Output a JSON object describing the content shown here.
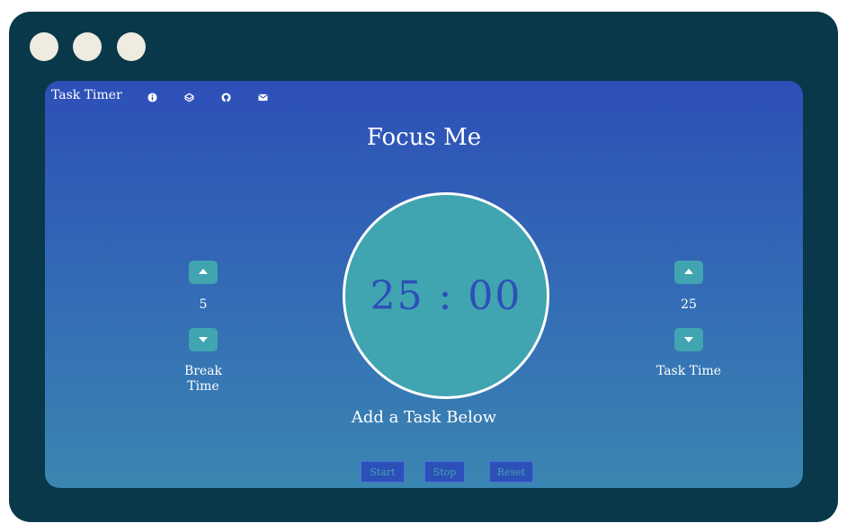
{
  "window": {
    "controls": [
      "circle-1",
      "circle-2",
      "circle-3"
    ]
  },
  "navbar": {
    "brand": "Task Timer",
    "icons": [
      "info-icon",
      "codepen-icon",
      "github-icon",
      "mail-icon"
    ]
  },
  "main": {
    "title": "Focus Me",
    "timer": {
      "display": "25 : 00"
    },
    "break": {
      "value": "5",
      "label": "Break Time"
    },
    "task": {
      "value": "25",
      "label": "Task Time"
    },
    "task_label": "Add a Task Below"
  },
  "controls": {
    "start": "Start",
    "stop": "Stop",
    "reset": "Reset"
  },
  "colors": {
    "frame": "#08384a",
    "gradient_top": "#2d4fb8",
    "gradient_bottom": "#3a86b2",
    "accent": "#40a4b1",
    "dot": "#efebe0"
  }
}
